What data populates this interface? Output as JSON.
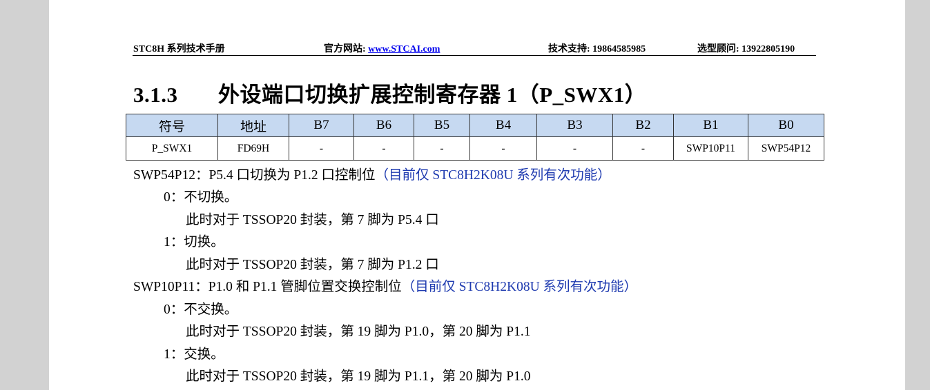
{
  "header": {
    "manual": "STC8H 系列技术手册",
    "website_label": "官方网站:",
    "website_link": "www.STCAI.com",
    "support": "技术支持: 19864585985",
    "advisor": "选型顾问: 13922805190"
  },
  "section": {
    "number": "3.1.3",
    "title": "外设端口切换扩展控制寄存器 1（P_SWX1）"
  },
  "register_table": {
    "headers": [
      "符号",
      "地址",
      "B7",
      "B6",
      "B5",
      "B4",
      "B3",
      "B2",
      "B1",
      "B0"
    ],
    "values": [
      "P_SWX1",
      "FD69H",
      "-",
      "-",
      "-",
      "-",
      "-",
      "-",
      "SWP10P11",
      "SWP54P12"
    ]
  },
  "body": {
    "swp54_desc": "SWP54P12：P5.4 口切换为 P1.2 口控制位",
    "swp54_note": "（目前仅 STC8H2K08U 系列有次功能）",
    "swp54_opt0": "0：不切换。",
    "swp54_opt0_detail": "此时对于 TSSOP20 封装，第 7 脚为 P5.4 口",
    "swp54_opt1": "1：切换。",
    "swp54_opt1_detail": "此时对于 TSSOP20 封装，第 7 脚为 P1.2 口",
    "swp10_desc": "SWP10P11：P1.0 和 P1.1 管脚位置交换控制位",
    "swp10_note": "（目前仅 STC8H2K08U 系列有次功能）",
    "swp10_opt0": "0：不交换。",
    "swp10_opt0_detail": "此时对于 TSSOP20 封装，第 19 脚为 P1.0，第 20 脚为 P1.1",
    "swp10_opt1": "1：交换。",
    "swp10_opt1_detail": "此时对于 TSSOP20 封装，第 19 脚为 P1.1，第 20 脚为 P1.0"
  }
}
